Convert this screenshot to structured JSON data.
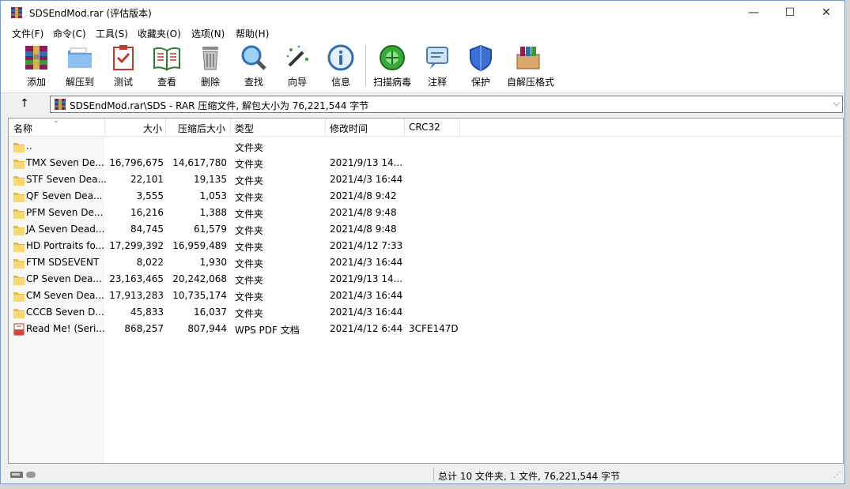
{
  "window": {
    "title": "SDSEndMod.rar (评估版本)",
    "minimize": "—",
    "maximize": "☐",
    "close": "✕"
  },
  "menu": [
    "文件(F)",
    "命令(C)",
    "工具(S)",
    "收藏夹(O)",
    "选项(N)",
    "帮助(H)"
  ],
  "toolbar": [
    {
      "label": "添加",
      "icon": "add-icon"
    },
    {
      "label": "解压到",
      "icon": "extract-to-icon"
    },
    {
      "label": "测试",
      "icon": "test-icon"
    },
    {
      "label": "查看",
      "icon": "view-icon"
    },
    {
      "label": "删除",
      "icon": "delete-icon"
    },
    {
      "label": "查找",
      "icon": "find-icon"
    },
    {
      "label": "向导",
      "icon": "wizard-icon"
    },
    {
      "label": "信息",
      "icon": "info-icon"
    },
    {
      "label": "扫描病毒",
      "icon": "virus-scan-icon"
    },
    {
      "label": "注释",
      "icon": "comment-icon"
    },
    {
      "label": "保护",
      "icon": "protect-icon"
    },
    {
      "label": "自解压格式",
      "icon": "sfx-icon"
    }
  ],
  "address": {
    "up": "↑",
    "path": "SDSEndMod.rar\\SDS - RAR 压缩文件, 解包大小为 76,221,544 字节",
    "dropdown": "⌵"
  },
  "columns": {
    "name": "名称",
    "size": "大小",
    "packed": "压缩后大小",
    "type": "类型",
    "modified": "修改时间",
    "crc": "CRC32"
  },
  "rows": [
    {
      "icon": "folder-icon",
      "name": "..",
      "size": "",
      "packed": "",
      "type": "文件夹",
      "modified": "",
      "crc": ""
    },
    {
      "icon": "folder-icon",
      "name": "TMX Seven De...",
      "size": "16,796,675",
      "packed": "14,617,780",
      "type": "文件夹",
      "modified": "2021/9/13 14...",
      "crc": ""
    },
    {
      "icon": "folder-icon",
      "name": "STF Seven Dea...",
      "size": "22,101",
      "packed": "19,135",
      "type": "文件夹",
      "modified": "2021/4/3 16:44",
      "crc": ""
    },
    {
      "icon": "folder-icon",
      "name": "QF Seven Dea...",
      "size": "3,555",
      "packed": "1,053",
      "type": "文件夹",
      "modified": "2021/4/8 9:42",
      "crc": ""
    },
    {
      "icon": "folder-icon",
      "name": "PFM Seven De...",
      "size": "16,216",
      "packed": "1,388",
      "type": "文件夹",
      "modified": "2021/4/8 9:48",
      "crc": ""
    },
    {
      "icon": "folder-icon",
      "name": "JA Seven Dead...",
      "size": "84,745",
      "packed": "61,579",
      "type": "文件夹",
      "modified": "2021/4/8 9:48",
      "crc": ""
    },
    {
      "icon": "folder-icon",
      "name": "HD Portraits fo...",
      "size": "17,299,392",
      "packed": "16,959,489",
      "type": "文件夹",
      "modified": "2021/4/12 7:33",
      "crc": ""
    },
    {
      "icon": "folder-icon",
      "name": "FTM SDSEVENT",
      "size": "8,022",
      "packed": "1,930",
      "type": "文件夹",
      "modified": "2021/4/3 16:44",
      "crc": ""
    },
    {
      "icon": "folder-icon",
      "name": "CP Seven Dea...",
      "size": "23,163,465",
      "packed": "20,242,068",
      "type": "文件夹",
      "modified": "2021/9/13 14...",
      "crc": ""
    },
    {
      "icon": "folder-icon",
      "name": "CM Seven Dea...",
      "size": "17,913,283",
      "packed": "10,735,174",
      "type": "文件夹",
      "modified": "2021/4/3 16:44",
      "crc": ""
    },
    {
      "icon": "folder-icon",
      "name": "CCCB Seven D...",
      "size": "45,833",
      "packed": "16,037",
      "type": "文件夹",
      "modified": "2021/4/3 16:44",
      "crc": ""
    },
    {
      "icon": "pdf-icon",
      "name": "Read Me! (Seri...",
      "size": "868,257",
      "packed": "807,944",
      "type": "WPS PDF 文档",
      "modified": "2021/4/12 6:44",
      "crc": "3CFE147D"
    }
  ],
  "status": {
    "summary": "总计 10 文件夹, 1 文件, 76,221,544 字节"
  },
  "colors": {
    "folder": "#f8d775",
    "folder_dark": "#e6b84a",
    "accent": "#0078d7"
  }
}
